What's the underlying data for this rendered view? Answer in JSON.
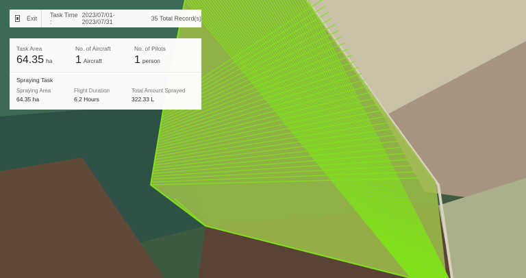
{
  "topbar": {
    "exit_label": "Exit",
    "task_time_label": "Task Time :",
    "task_time_value": "2023/07/01-2023/07/31",
    "records": "35 Total Record(s)"
  },
  "summary": {
    "task_area": {
      "label": "Task Area",
      "value": "64.35",
      "unit": "ha"
    },
    "aircraft": {
      "label": "No. of Aircraft",
      "value": "1",
      "unit": "Aircraft"
    },
    "pilots": {
      "label": "No. of Pilots",
      "value": "1",
      "unit": "person"
    }
  },
  "task": {
    "title": "Spraying Task",
    "spraying_area": {
      "label": "Spraying Area",
      "value": "64.35 ha"
    },
    "flight_duration": {
      "label": "Flight Duration",
      "value": "6.2 Hours"
    },
    "total_sprayed": {
      "label": "Total Amount Sprayed",
      "value": "322.33 L"
    }
  },
  "colors": {
    "flight_path": "#7fe21a",
    "field_fill": "#9fbf4a",
    "panel_bg": "#ffffff"
  },
  "icons": {
    "exit": "exit-icon"
  }
}
